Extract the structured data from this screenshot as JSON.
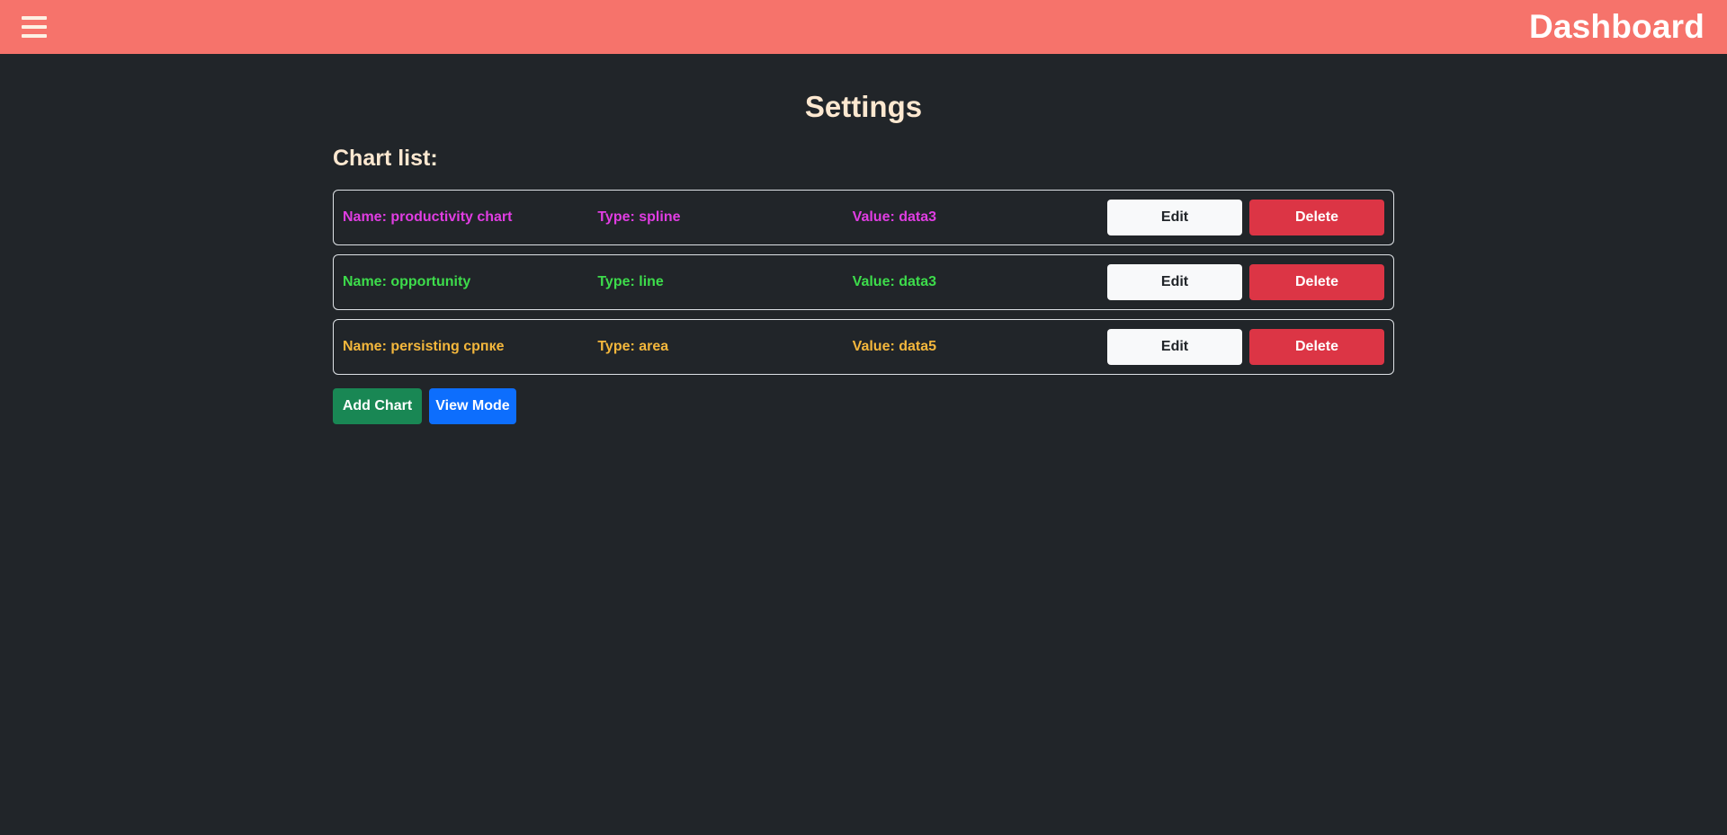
{
  "header": {
    "menu_icon": "hamburger-menu-icon",
    "title": "Dashboard",
    "background": "#f6736b"
  },
  "page": {
    "title": "Settings",
    "section_title": "Chart list:"
  },
  "charts": [
    {
      "name": "Name: productivity chart",
      "type": "Type: spline",
      "value": "Value: data3",
      "color": "#e03de2",
      "edit_label": "Edit",
      "delete_label": "Delete"
    },
    {
      "name": "Name: opportunity",
      "type": "Type: line",
      "value": "Value: data3",
      "color": "#3ddc4b",
      "edit_label": "Edit",
      "delete_label": "Delete"
    },
    {
      "name": "Name: persisting српке",
      "type": "Type: area",
      "value": "Value: data5",
      "color": "#f4b73c",
      "edit_label": "Edit",
      "delete_label": "Delete"
    }
  ],
  "actions": {
    "add_label": "Add Chart",
    "view_label": "View Mode"
  },
  "colors": {
    "background": "#212529",
    "title_text": "#fde8d0",
    "edit_button": "#f8f9fa",
    "delete_button": "#dc3545",
    "add_button": "#198754",
    "view_button": "#0d6efd"
  }
}
